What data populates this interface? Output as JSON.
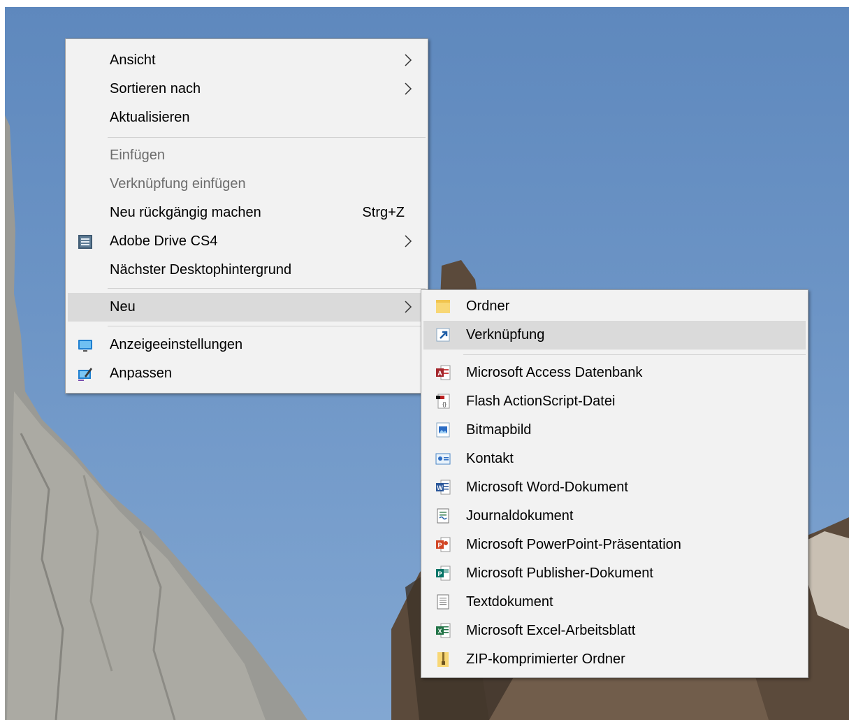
{
  "context_menu": {
    "items": [
      {
        "label": "Ansicht"
      },
      {
        "label": "Sortieren nach"
      },
      {
        "label": "Aktualisieren"
      },
      {
        "label": "Einfügen"
      },
      {
        "label": "Verknüpfung einfügen"
      },
      {
        "label": "Neu rückgängig machen",
        "shortcut": "Strg+Z"
      },
      {
        "label": "Adobe Drive CS4"
      },
      {
        "label": "Nächster Desktophintergrund"
      },
      {
        "label": "Neu"
      },
      {
        "label": "Anzeigeeinstellungen"
      },
      {
        "label": "Anpassen"
      }
    ]
  },
  "new_submenu": {
    "items": [
      {
        "label": "Ordner"
      },
      {
        "label": "Verknüpfung"
      },
      {
        "label": "Microsoft Access Datenbank"
      },
      {
        "label": "Flash ActionScript-Datei"
      },
      {
        "label": "Bitmapbild"
      },
      {
        "label": "Kontakt"
      },
      {
        "label": "Microsoft Word-Dokument"
      },
      {
        "label": "Journaldokument"
      },
      {
        "label": "Microsoft PowerPoint-Präsentation"
      },
      {
        "label": "Microsoft Publisher-Dokument"
      },
      {
        "label": "Textdokument"
      },
      {
        "label": "Microsoft Excel-Arbeitsblatt"
      },
      {
        "label": "ZIP-komprimierter Ordner"
      }
    ]
  },
  "colors": {
    "menu_background": "#f2f2f2",
    "highlight": "#dadada",
    "disabled_text": "#6d6d6d",
    "sky": "#6d95c6"
  }
}
